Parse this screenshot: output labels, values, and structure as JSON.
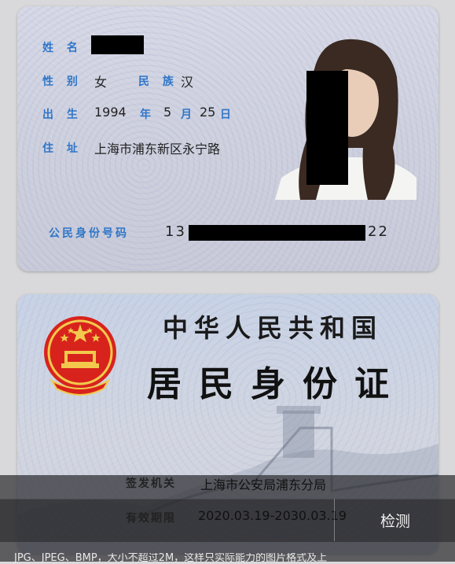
{
  "id_front": {
    "name_label": "姓 名",
    "gender_label": "性 别",
    "gender_value": "女",
    "ethnicity_label": "民 族",
    "ethnicity_value": "汉",
    "birth_label": "出 生",
    "birth_year": "1994",
    "year_unit": "年",
    "birth_month": "5",
    "month_unit": "月",
    "birth_day": "25",
    "day_unit": "日",
    "address_label": "住 址",
    "address_value": "上海市浦东新区永宁路",
    "id_number_label": "公民身份号码",
    "id_number_prefix": "13",
    "id_number_suffix": "22"
  },
  "id_back": {
    "country_title": "中华人民共和国",
    "card_title": "居民身份证",
    "authority_label": "签发机关",
    "authority_value": "上海市公安局浦东分局",
    "validity_label": "有效期限",
    "validity_value": "2020.03.19-2030.03.19"
  },
  "actions": {
    "detect_label": "检测"
  },
  "footer": {
    "hint_text": "JPG、JPEG、BMP，大小不超过2M，这样只实际能力的图片格式及上"
  },
  "colors": {
    "label_blue": "#2f76c8",
    "emblem_red": "#d8231d",
    "overlay": "#2d2d30"
  }
}
